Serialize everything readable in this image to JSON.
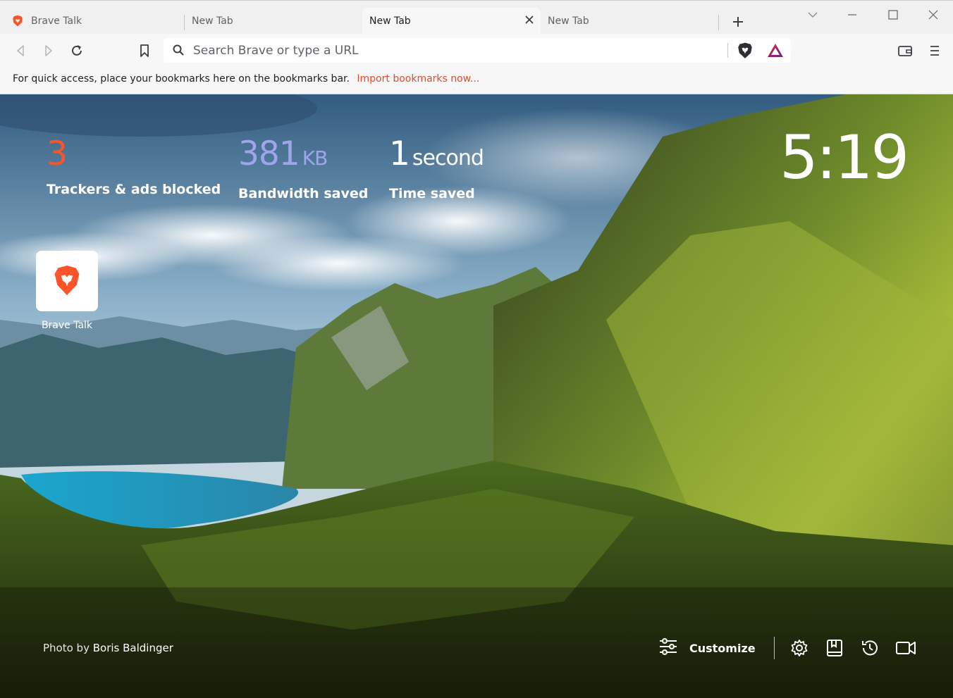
{
  "tabs": [
    {
      "label": "Brave Talk",
      "active": false
    },
    {
      "label": "New Tab",
      "active": false
    },
    {
      "label": "New Tab",
      "active": true
    },
    {
      "label": "New Tab",
      "active": false
    }
  ],
  "toolbar": {
    "address_placeholder": "Search Brave or type a URL",
    "address_value": ""
  },
  "bookmarks_bar": {
    "message": "For quick access, place your bookmarks here on the bookmarks bar.",
    "import_link": "Import bookmarks now..."
  },
  "stats": {
    "trackers": {
      "value": "3",
      "label": "Trackers & ads blocked"
    },
    "bandwidth": {
      "value": "381",
      "unit": "KB",
      "label": "Bandwidth saved"
    },
    "time": {
      "value": "1",
      "unit": "second",
      "label": "Time saved"
    }
  },
  "clock": "5:19",
  "top_sites": [
    {
      "label": "Brave Talk"
    }
  ],
  "photo_credit": {
    "prefix": "Photo by",
    "author": "Boris Baldinger"
  },
  "footer": {
    "customize_label": "Customize"
  },
  "colors": {
    "brand": "#fb542b",
    "bandwidth_accent": "#a0a5eb",
    "link": "#e34a2c"
  },
  "icons": [
    "brave-lion-icon",
    "close-icon",
    "plus-icon",
    "chevron-down-icon",
    "minimize-icon",
    "maximize-icon",
    "back-icon",
    "forward-icon",
    "reload-icon",
    "bookmark-icon",
    "search-icon",
    "brave-shields-icon",
    "brave-rewards-icon",
    "wallet-icon",
    "menu-icon",
    "customize-sliders-icon",
    "settings-gear-icon",
    "bookmarks-icon",
    "history-icon",
    "brave-talk-camera-icon"
  ]
}
